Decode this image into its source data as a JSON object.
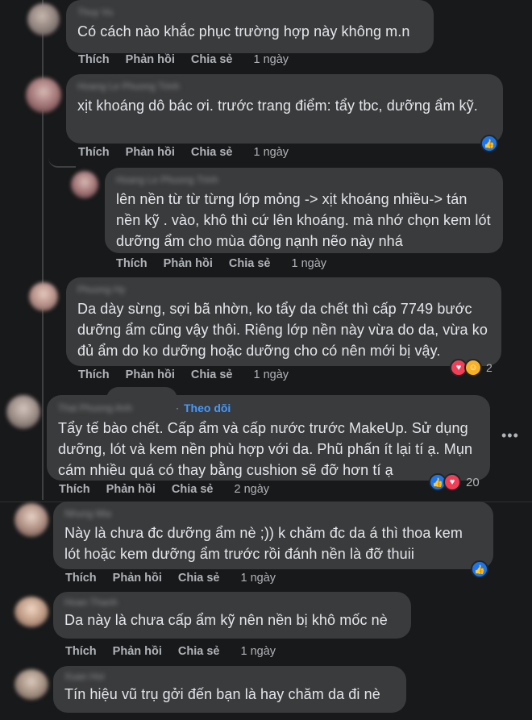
{
  "comments": [
    {
      "author": "Thuy Vu",
      "text": "Có cách nào khắc phục trường hợp này không m.n",
      "actions": {
        "like": "Thích",
        "reply": "Phản hồi",
        "share": "Chia sẻ",
        "time": "1 ngày"
      }
    },
    {
      "author": "Hoang Le Phuong Trinh",
      "text": "xịt khoáng dô bác ơi. trước trang điểm: tẩy tbc, dưỡng ẩm kỹ.",
      "actions": {
        "like": "Thích",
        "reply": "Phản hồi",
        "share": "Chia sẻ",
        "time": "1 ngày"
      },
      "reaction_icons": [
        "like"
      ]
    },
    {
      "author": "Hoang Le Phuong Trinh",
      "text": "lên nền từ từ từng lớp mỏng -> xịt khoáng nhiều-> tán nền kỹ . vào, khô thì cứ lên khoáng. mà nhớ chọn kem lót dưỡng ẩm cho mùa đông nạnh nẽo này nhá",
      "actions": {
        "like": "Thích",
        "reply": "Phản hồi",
        "share": "Chia sẻ",
        "time": "1 ngày"
      }
    },
    {
      "author": "Phuong Hy",
      "text": "Da dày sừng, sợi bã nhờn, ko tẩy da chết thì cấp 7749 bước dưỡng ẩm cũng vậy thôi. Riêng lớp nền này vừa do da, vừa ko đủ ẩm do ko dưỡng hoặc dưỡng cho có nên mới bị vậy.",
      "actions": {
        "like": "Thích",
        "reply": "Phản hồi",
        "share": "Chia sẻ",
        "time": "1 ngày"
      },
      "reaction_icons": [
        "love",
        "care"
      ],
      "reaction_count": "2"
    },
    {
      "author": "Thai Phuong Anh",
      "follow": "Theo dõi",
      "text": "Tẩy tế bào chết. Cấp ẩm và cấp nước trước MakeUp. Sử dụng dưỡng, lót và kem nền phù hợp với da. Phũ phấn ít lại tí ạ. Mụn cám nhiều quá có thay bằng cushion sẽ đỡ hơn tí ạ",
      "actions": {
        "like": "Thích",
        "reply": "Phản hồi",
        "share": "Chia sẻ",
        "time": "2 ngày"
      },
      "reaction_icons": [
        "like",
        "love"
      ],
      "reaction_count": "20"
    },
    {
      "author": "Nhung Mia",
      "text": "Này là chưa đc dưỡng ẩm nè ;)) k chăm đc da á thì thoa kem lót hoặc kem dưỡng ẩm trước rồi đánh nền là đỡ thuii",
      "actions": {
        "like": "Thích",
        "reply": "Phản hồi",
        "share": "Chia sẻ",
        "time": "1 ngày"
      },
      "reaction_icons": [
        "like"
      ]
    },
    {
      "author": "Hoan Thanh",
      "text": "Da này là chưa cấp ẩm kỹ nên nền bị khô mốc nè",
      "actions": {
        "like": "Thích",
        "reply": "Phản hồi",
        "share": "Chia sẻ",
        "time": "1 ngày"
      }
    },
    {
      "author": "Xuan Hoi",
      "text": "Tín hiệu vũ trụ gởi đến bạn là hay chăm da đi nè"
    }
  ],
  "more_options": "•••"
}
